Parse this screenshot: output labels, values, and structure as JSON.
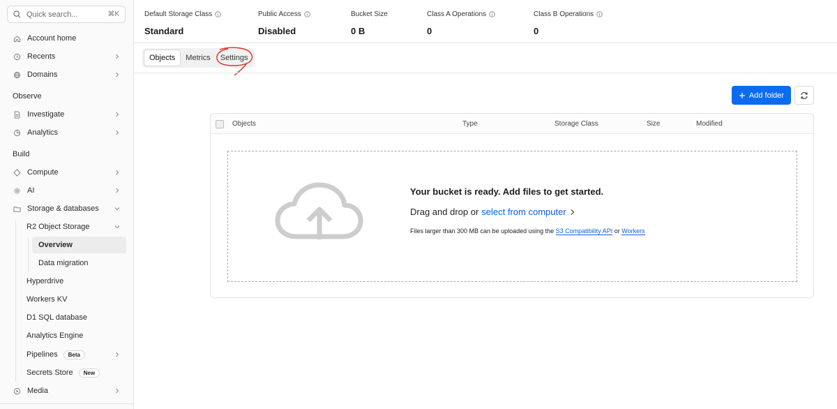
{
  "sidebar": {
    "search": {
      "placeholder": "Quick search...",
      "shortcut": "⌘K"
    },
    "top_items": [
      {
        "label": "Account home",
        "icon": "home-icon"
      },
      {
        "label": "Recents",
        "icon": "clock-icon"
      },
      {
        "label": "Domains",
        "icon": "globe-icon"
      }
    ],
    "sections": {
      "observe": "Observe",
      "build": "Build"
    },
    "observe_items": [
      {
        "label": "Investigate",
        "icon": "document-icon"
      },
      {
        "label": "Analytics",
        "icon": "pie-icon"
      }
    ],
    "build_items": [
      {
        "label": "Compute",
        "icon": "diamond-icon"
      },
      {
        "label": "AI",
        "icon": "sparkle-icon"
      },
      {
        "label": "Storage & databases",
        "icon": "folder-icon"
      }
    ],
    "storage_children": {
      "r2": "R2 Object Storage",
      "overview": "Overview",
      "data_migration": "Data migration",
      "hyperdrive": "Hyperdrive",
      "workers_kv": "Workers KV",
      "d1": "D1 SQL database",
      "analytics_engine": "Analytics Engine",
      "pipelines": "Pipelines",
      "pipelines_badge": "Beta",
      "secrets_store": "Secrets Store",
      "secrets_badge": "New"
    },
    "media": {
      "label": "Media",
      "icon": "play-icon"
    }
  },
  "stats": [
    {
      "label": "Default Storage Class",
      "value": "Standard"
    },
    {
      "label": "Public Access",
      "value": "Disabled"
    },
    {
      "label": "Bucket Size",
      "value": "0 B"
    },
    {
      "label": "Class A Operations",
      "value": "0"
    },
    {
      "label": "Class B Operations",
      "value": "0"
    }
  ],
  "tabs": [
    "Objects",
    "Metrics",
    "Settings"
  ],
  "active_tab": "Objects",
  "actions": {
    "add_folder": "Add folder"
  },
  "table": {
    "columns": [
      "Objects",
      "Type",
      "Storage Class",
      "Size",
      "Modified"
    ]
  },
  "dropzone": {
    "title": "Your bucket is ready. Add files to get started.",
    "drag_text": "Drag and drop or",
    "select_link": "select from computer",
    "note_prefix": "Files larger than 300 MB can be uploaded using the",
    "note_link1": "S3 Compatibility API",
    "note_or": "or",
    "note_link2": "Workers"
  },
  "colors": {
    "accent": "#0a6cf1",
    "annotation": "#d93025"
  }
}
